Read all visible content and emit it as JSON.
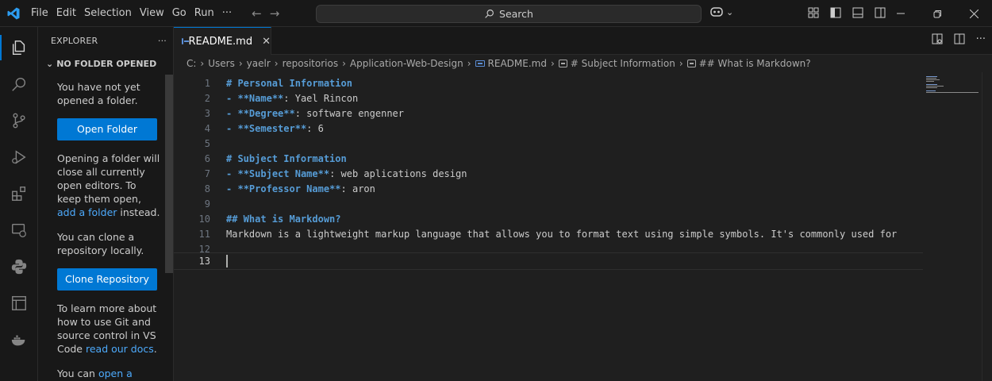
{
  "menu": [
    "File",
    "Edit",
    "Selection",
    "View",
    "Go",
    "Run",
    "···"
  ],
  "search": {
    "label": "Search"
  },
  "sidebar": {
    "title": "EXPLORER",
    "more": "···",
    "section": "NO FOLDER OPENED",
    "msg1": "You have not yet opened a folder.",
    "open_folder_button": "Open Folder",
    "msg2_prefix": "Opening a folder will close all currently open editors. To keep them open, ",
    "msg2_link": "add a folder",
    "msg2_suffix": " instead.",
    "msg3": "You can clone a repository locally.",
    "clone_button": "Clone Repository",
    "msg4_prefix": "To learn more about how to use Git and source control in VS Code ",
    "msg4_link": "read our docs",
    "msg4_suffix": ".",
    "msg5_prefix": "You can ",
    "msg5_link": "open a folder"
  },
  "tab": {
    "label": "README.md",
    "close": "✕"
  },
  "breadcrumb": {
    "items": [
      "C:",
      "Users",
      "yaelr",
      "repositorios",
      "Application-Web-Design",
      "README.md",
      "# Subject Information",
      "## What is Markdown?"
    ],
    "sep": "›"
  },
  "editor": {
    "lines": [
      {
        "n": "1",
        "code": "# Personal Information"
      },
      {
        "n": "2",
        "code": "- **Name**: Yael Rincon"
      },
      {
        "n": "3",
        "code": "- **Degree**: software engenner"
      },
      {
        "n": "4",
        "code": "- **Semester**: 6"
      },
      {
        "n": "5",
        "code": ""
      },
      {
        "n": "6",
        "code": "# Subject Information"
      },
      {
        "n": "7",
        "code": "- **Subject Name**: web aplications design"
      },
      {
        "n": "8",
        "code": "- **Professor Name**: aron"
      },
      {
        "n": "9",
        "code": ""
      },
      {
        "n": "10",
        "code": "## What is Markdown?"
      },
      {
        "n": "11",
        "code": "Markdown is a lightweight markup language that allows you to format text using simple symbols. It's commonly used for"
      },
      {
        "n": "12",
        "code": ""
      },
      {
        "n": "13",
        "code": ""
      }
    ],
    "current_line": "13"
  },
  "colors": {
    "accent": "#0078d4",
    "heading": "#569cd6",
    "link": "#4daafc"
  }
}
